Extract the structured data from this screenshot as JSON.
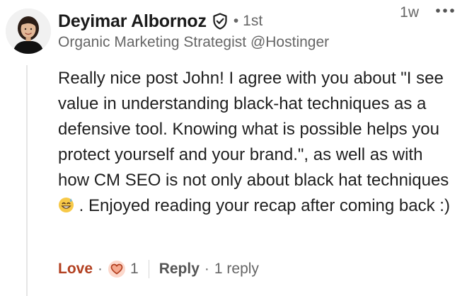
{
  "comment": {
    "author_name": "Deyimar Albornoz",
    "connection_degree": "1st",
    "degree_separator": "•",
    "headline": "Organic Marketing Strategist @Hostinger",
    "timestamp": "1w",
    "body_before_emoji": "Really nice post John! I agree with you about \"I see value in understanding black-hat techniques as a defensive tool. Knowing what is possible helps you protect yourself and your brand.\", as well as with how CM SEO is not only about black hat techniques ",
    "emoji_name": "grinning-face-with-sweat",
    "body_after_emoji": " . Enjoyed reading your recap after coming back :)"
  },
  "actions": {
    "love_label": "Love",
    "separator": "·",
    "reaction_icon": "heart-icon",
    "reaction_count": "1",
    "reply_label": "Reply",
    "reply_count_label": "1 reply"
  },
  "icons": {
    "verified": "verified-shield-icon",
    "more": "more-options-icon"
  },
  "colors": {
    "love_accent": "#b24020",
    "secondary_text": "#666666",
    "primary_text": "#1f1f1f",
    "heart_fill": "#fcd8cc"
  }
}
